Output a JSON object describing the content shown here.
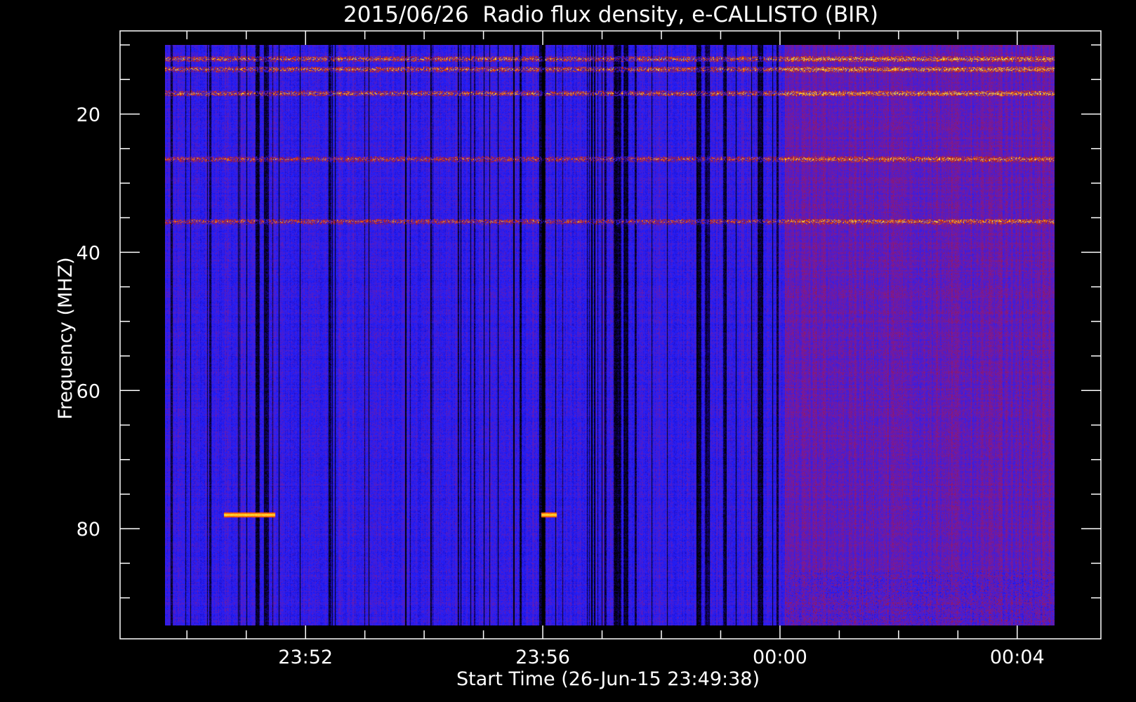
{
  "chart_data": {
    "type": "heatmap",
    "title": "2015/06/26  Radio flux density, e-CALLISTO (BIR)",
    "xlabel": "Start Time (26-Jun-15 23:49:38)",
    "ylabel": "Frequency (MHZ)",
    "x_range_minutes_after_start": [
      0,
      15.0
    ],
    "y_range_mhz": [
      10,
      94
    ],
    "y_axis_inverted": true,
    "grid": false,
    "xticks": [
      {
        "label": "23:52",
        "minutes_after_start": 2.37
      },
      {
        "label": "23:56",
        "minutes_after_start": 6.37
      },
      {
        "label": "00:00",
        "minutes_after_start": 10.37
      },
      {
        "label": "00:04",
        "minutes_after_start": 14.37
      }
    ],
    "yticks": [
      {
        "label": "20",
        "mhz": 20
      },
      {
        "label": "40",
        "mhz": 40
      },
      {
        "label": "60",
        "mhz": 60
      },
      {
        "label": "80",
        "mhz": 80
      }
    ],
    "colormap": [
      "#000000",
      "#1a00a0",
      "#2020ff",
      "#7a1a9a",
      "#b01818",
      "#ff6000",
      "#ffff40"
    ],
    "features": {
      "bright_bands_mhz": [
        12,
        13.5,
        17,
        26.5,
        35.5
      ],
      "short_bursts": [
        {
          "mhz": 78,
          "minutes_after_start": [
            1.0,
            1.85
          ]
        },
        {
          "mhz": 78,
          "minutes_after_start": [
            6.35,
            6.6
          ]
        }
      ],
      "background_change_minutes_after_start": 10.45
    }
  }
}
